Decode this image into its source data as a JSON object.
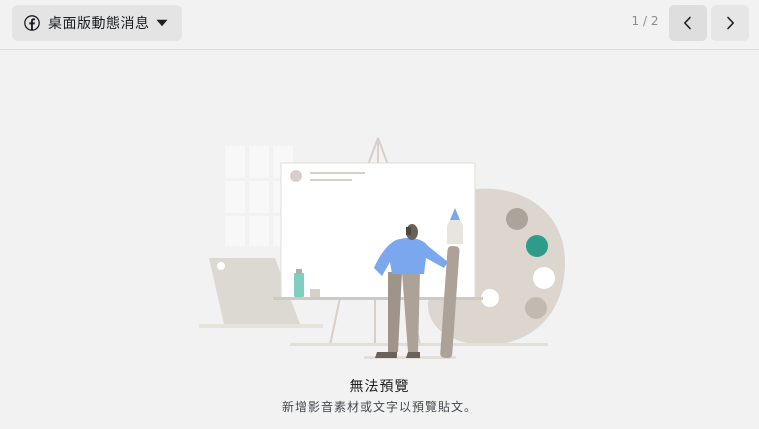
{
  "toolbar": {
    "placement_label": "桌面版動態消息",
    "page_indicator": "1 / 2",
    "prev_icon": "chevron-left-icon",
    "next_icon": "chevron-right-icon",
    "platform_icon": "facebook-icon",
    "dropdown_icon": "caret-down-icon"
  },
  "empty_state": {
    "title": "無法預覽",
    "description": "新增影音素材或文字以預覽貼文。",
    "illustration": "artist-painting-canvas-illustration"
  },
  "colors": {
    "background": "#f2f2f2",
    "select_bg": "#e4e4e4",
    "accent_teal": "#2e9c8a",
    "shirt_blue": "#7ba7ee",
    "palette_tan": "#d6d0c8"
  }
}
